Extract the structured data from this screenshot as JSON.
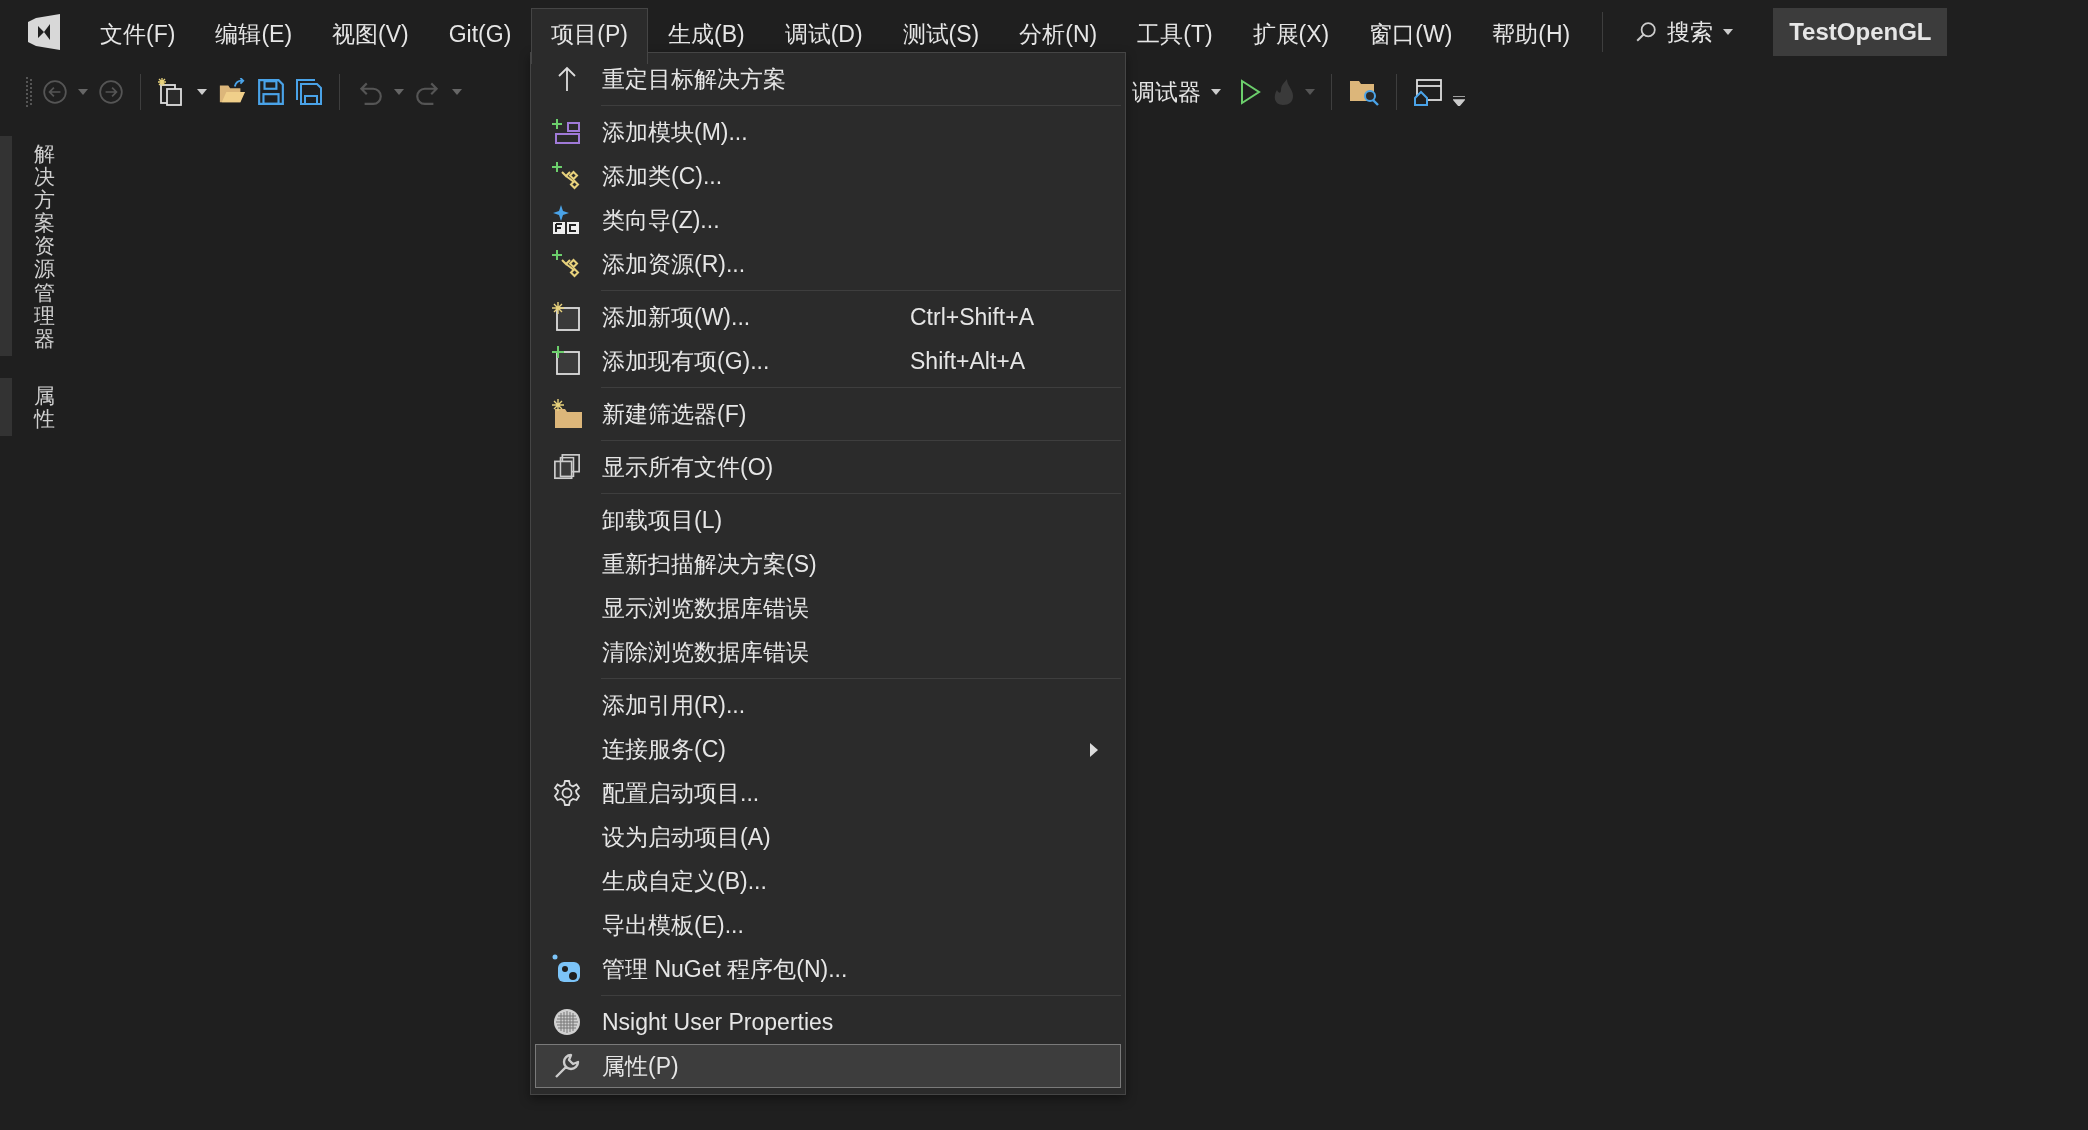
{
  "menu_bar": {
    "items": [
      {
        "label": "文件(F)",
        "selected": false
      },
      {
        "label": "编辑(E)",
        "selected": false
      },
      {
        "label": "视图(V)",
        "selected": false
      },
      {
        "label": "Git(G)",
        "selected": false
      },
      {
        "label": "项目(P)",
        "selected": true
      },
      {
        "label": "生成(B)",
        "selected": false
      },
      {
        "label": "调试(D)",
        "selected": false
      },
      {
        "label": "测试(S)",
        "selected": false
      },
      {
        "label": "分析(N)",
        "selected": false
      },
      {
        "label": "工具(T)",
        "selected": false
      },
      {
        "label": "扩展(X)",
        "selected": false
      },
      {
        "label": "窗口(W)",
        "selected": false
      },
      {
        "label": "帮助(H)",
        "selected": false
      }
    ],
    "search": {
      "label": "搜索"
    },
    "solution_name": "TestOpenGL"
  },
  "toolbar": {
    "debugger_label": "调试器"
  },
  "side_tabs": [
    {
      "label": "解决方案资源管理器"
    },
    {
      "label": "属性"
    }
  ],
  "project_menu": {
    "items": [
      {
        "kind": "retarget",
        "label": "重定目标解决方案",
        "selected": false,
        "has_submenu": false
      },
      {
        "kind": "separator"
      },
      {
        "kind": "module",
        "label": "添加模块(M)...",
        "selected": false,
        "has_submenu": false
      },
      {
        "kind": "class",
        "label": "添加类(C)...",
        "selected": false,
        "has_submenu": false
      },
      {
        "kind": "wizard",
        "label": "类向导(Z)...",
        "selected": false,
        "has_submenu": false
      },
      {
        "kind": "class",
        "label": "添加资源(R)...",
        "selected": false,
        "has_submenu": false
      },
      {
        "kind": "separator"
      },
      {
        "kind": "newitem",
        "label": "添加新项(W)...",
        "shortcut": "Ctrl+Shift+A",
        "selected": false,
        "has_submenu": false
      },
      {
        "kind": "existingitem",
        "label": "添加现有项(G)...",
        "shortcut": "Shift+Alt+A",
        "selected": false,
        "has_submenu": false
      },
      {
        "kind": "separator"
      },
      {
        "kind": "filter",
        "label": "新建筛选器(F)",
        "selected": false,
        "has_submenu": false
      },
      {
        "kind": "separator"
      },
      {
        "kind": "showall",
        "label": "显示所有文件(O)",
        "selected": false,
        "has_submenu": false
      },
      {
        "kind": "separator"
      },
      {
        "kind": "plain",
        "label": "卸载项目(L)",
        "selected": false,
        "has_submenu": false
      },
      {
        "kind": "plain",
        "label": "重新扫描解决方案(S)",
        "selected": false,
        "has_submenu": false
      },
      {
        "kind": "plain",
        "label": "显示浏览数据库错误",
        "selected": false,
        "has_submenu": false
      },
      {
        "kind": "plain",
        "label": "清除浏览数据库错误",
        "selected": false,
        "has_submenu": false
      },
      {
        "kind": "separator"
      },
      {
        "kind": "plain",
        "label": "添加引用(R)...",
        "selected": false,
        "has_submenu": false
      },
      {
        "kind": "plain",
        "label": "连接服务(C)",
        "selected": false,
        "has_submenu": true
      },
      {
        "kind": "gear",
        "label": "配置启动项目...",
        "selected": false,
        "has_submenu": false
      },
      {
        "kind": "plain",
        "label": "设为启动项目(A)",
        "selected": false,
        "has_submenu": false
      },
      {
        "kind": "plain",
        "label": "生成自定义(B)...",
        "selected": false,
        "has_submenu": false
      },
      {
        "kind": "plain",
        "label": "导出模板(E)...",
        "selected": false,
        "has_submenu": false
      },
      {
        "kind": "nuget",
        "label": "管理 NuGet 程序包(N)...",
        "selected": false,
        "has_submenu": false
      },
      {
        "kind": "separator"
      },
      {
        "kind": "nsight",
        "label": "Nsight User Properties",
        "selected": false,
        "has_submenu": false
      },
      {
        "kind": "wrench",
        "label": "属性(P)",
        "selected": true,
        "has_submenu": false
      }
    ]
  }
}
